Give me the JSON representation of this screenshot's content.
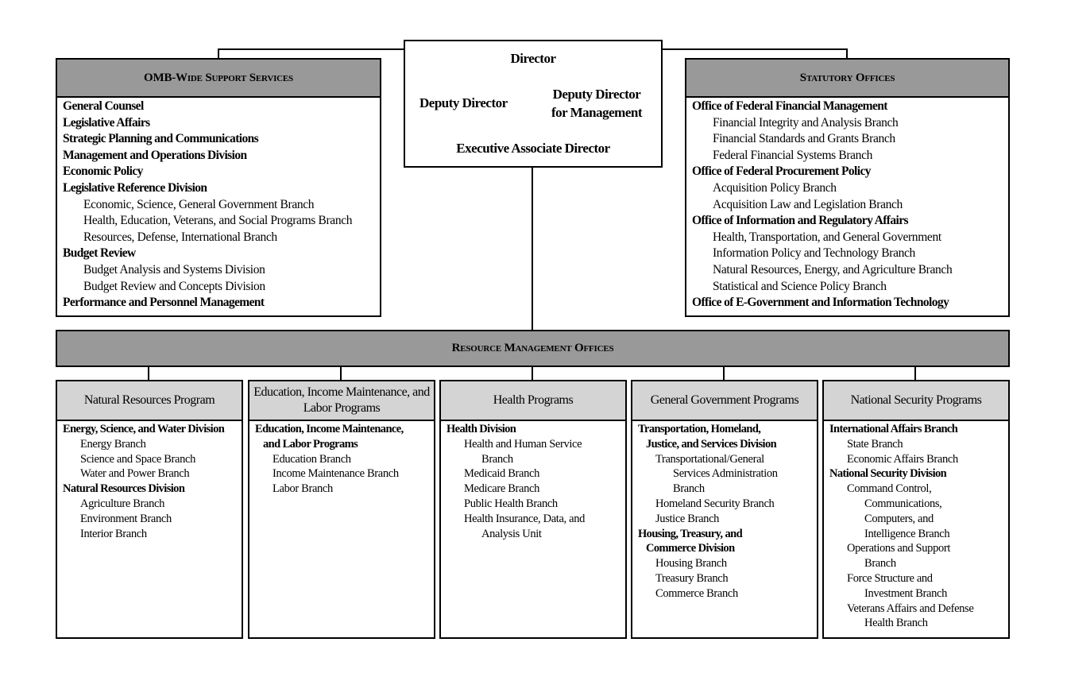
{
  "director": {
    "title": "Director",
    "deputy": "Deputy Director",
    "deputy_mgmt": "Deputy Director for Management",
    "exec_assoc": "Executive Associate Director"
  },
  "omb_wide": {
    "title": "OMB-Wide Support Services",
    "lines": [
      {
        "t": "General Counsel",
        "l": 0,
        "b": true
      },
      {
        "t": "Legislative Affairs",
        "l": 0,
        "b": true
      },
      {
        "t": "Strategic Planning and Communications",
        "l": 0,
        "b": true
      },
      {
        "t": "Management and Operations Division",
        "l": 0,
        "b": true
      },
      {
        "t": "Economic Policy",
        "l": 0,
        "b": true
      },
      {
        "t": "Legislative Reference Division",
        "l": 0,
        "b": true
      },
      {
        "t": "Economic, Science, General Government Branch",
        "l": 1,
        "b": false
      },
      {
        "t": "Health, Education, Veterans, and Social Programs Branch",
        "l": 1,
        "b": false
      },
      {
        "t": "Resources, Defense, International Branch",
        "l": 1,
        "b": false
      },
      {
        "t": "Budget Review",
        "l": 0,
        "b": true
      },
      {
        "t": "Budget Analysis and Systems Division",
        "l": 1,
        "b": false
      },
      {
        "t": "Budget Review and Concepts Division",
        "l": 1,
        "b": false
      },
      {
        "t": "Performance and Personnel Management",
        "l": 0,
        "b": true
      }
    ]
  },
  "statutory": {
    "title": "Statutory Offices",
    "lines": [
      {
        "t": "Office of Federal Financial Management",
        "l": 0,
        "b": true
      },
      {
        "t": "Financial Integrity and Analysis Branch",
        "l": 1,
        "b": false
      },
      {
        "t": "Financial Standards and Grants Branch",
        "l": 1,
        "b": false
      },
      {
        "t": "Federal Financial Systems Branch",
        "l": 1,
        "b": false
      },
      {
        "t": "Office of Federal Procurement Policy",
        "l": 0,
        "b": true
      },
      {
        "t": "Acquisition Policy Branch",
        "l": 1,
        "b": false
      },
      {
        "t": "Acquisition Law and Legislation Branch",
        "l": 1,
        "b": false
      },
      {
        "t": "Office of Information and Regulatory Affairs",
        "l": 0,
        "b": true
      },
      {
        "t": "Health, Transportation, and General Government",
        "l": 1,
        "b": false
      },
      {
        "t": "Information Policy and Technology Branch",
        "l": 1,
        "b": false
      },
      {
        "t": "Natural Resources, Energy, and Agriculture Branch",
        "l": 1,
        "b": false
      },
      {
        "t": "Statistical and Science Policy Branch",
        "l": 1,
        "b": false
      },
      {
        "t": "Office of E-Government and Information Technology",
        "l": 0,
        "b": true
      }
    ]
  },
  "resource": {
    "title": "Resource Management Offices"
  },
  "programs": [
    {
      "title": "Natural Resources Program",
      "lines": [
        {
          "t": "Energy, Science, and Water Division",
          "l": 0,
          "b": true
        },
        {
          "t": "Energy Branch",
          "l": 2,
          "b": false
        },
        {
          "t": "Science and Space Branch",
          "l": 2,
          "b": false
        },
        {
          "t": "Water and Power Branch",
          "l": 2,
          "b": false
        },
        {
          "t": "Natural Resources Division",
          "l": 0,
          "b": true
        },
        {
          "t": "Agriculture Branch",
          "l": 2,
          "b": false
        },
        {
          "t": "Environment Branch",
          "l": 2,
          "b": false
        },
        {
          "t": "Interior Branch",
          "l": 2,
          "b": false
        }
      ]
    },
    {
      "title": "Education, Income Maintenance, and Labor Programs",
      "lines": [
        {
          "t": "Education, Income Maintenance,",
          "l": 0,
          "b": true
        },
        {
          "t": "and Labor Programs",
          "l": 1,
          "b": true
        },
        {
          "t": "Education Branch",
          "l": 2,
          "b": false
        },
        {
          "t": "Income Maintenance Branch",
          "l": 2,
          "b": false
        },
        {
          "t": "Labor Branch",
          "l": 2,
          "b": false
        }
      ]
    },
    {
      "title": "Health Programs",
      "lines": [
        {
          "t": "Health Division",
          "l": 0,
          "b": true
        },
        {
          "t": "Health and Human Service",
          "l": 2,
          "b": false
        },
        {
          "t": "Branch",
          "l": 3,
          "b": false
        },
        {
          "t": "Medicaid Branch",
          "l": 2,
          "b": false
        },
        {
          "t": "Medicare Branch",
          "l": 2,
          "b": false
        },
        {
          "t": "Public Health Branch",
          "l": 2,
          "b": false
        },
        {
          "t": "Health Insurance, Data, and",
          "l": 2,
          "b": false
        },
        {
          "t": "Analysis Unit",
          "l": 3,
          "b": false
        }
      ]
    },
    {
      "title": "General Government Programs",
      "lines": [
        {
          "t": "Transportation, Homeland,",
          "l": 0,
          "b": true
        },
        {
          "t": "Justice, and Services Division",
          "l": 1,
          "b": true
        },
        {
          "t": "Transportational/General",
          "l": 2,
          "b": false
        },
        {
          "t": "Services Administration",
          "l": 3,
          "b": false
        },
        {
          "t": "Branch",
          "l": 3,
          "b": false
        },
        {
          "t": "Homeland Security Branch",
          "l": 2,
          "b": false
        },
        {
          "t": "Justice Branch",
          "l": 2,
          "b": false
        },
        {
          "t": "Housing, Treasury, and",
          "l": 0,
          "b": true
        },
        {
          "t": "Commerce Division",
          "l": 1,
          "b": true
        },
        {
          "t": "Housing Branch",
          "l": 2,
          "b": false
        },
        {
          "t": "Treasury Branch",
          "l": 2,
          "b": false
        },
        {
          "t": "Commerce Branch",
          "l": 2,
          "b": false
        }
      ]
    },
    {
      "title": "National Security Programs",
      "lines": [
        {
          "t": "International Affairs Branch",
          "l": 0,
          "b": true
        },
        {
          "t": "State Branch",
          "l": 2,
          "b": false
        },
        {
          "t": "Economic Affairs Branch",
          "l": 2,
          "b": false
        },
        {
          "t": "National Security Division",
          "l": 0,
          "b": true
        },
        {
          "t": "Command Control,",
          "l": 2,
          "b": false
        },
        {
          "t": "Communications,",
          "l": 3,
          "b": false
        },
        {
          "t": "Computers, and",
          "l": 3,
          "b": false
        },
        {
          "t": "Intelligence Branch",
          "l": 3,
          "b": false
        },
        {
          "t": "Operations and Support",
          "l": 2,
          "b": false
        },
        {
          "t": "Branch",
          "l": 3,
          "b": false
        },
        {
          "t": "Force Structure and",
          "l": 2,
          "b": false
        },
        {
          "t": "Investment Branch",
          "l": 3,
          "b": false
        },
        {
          "t": "Veterans Affairs and Defense",
          "l": 2,
          "b": false
        },
        {
          "t": "Health Branch",
          "l": 3,
          "b": false
        }
      ]
    }
  ],
  "colors": {
    "top_header": "#999999",
    "program_header": "#d4d4d4",
    "lines": "#000000"
  }
}
